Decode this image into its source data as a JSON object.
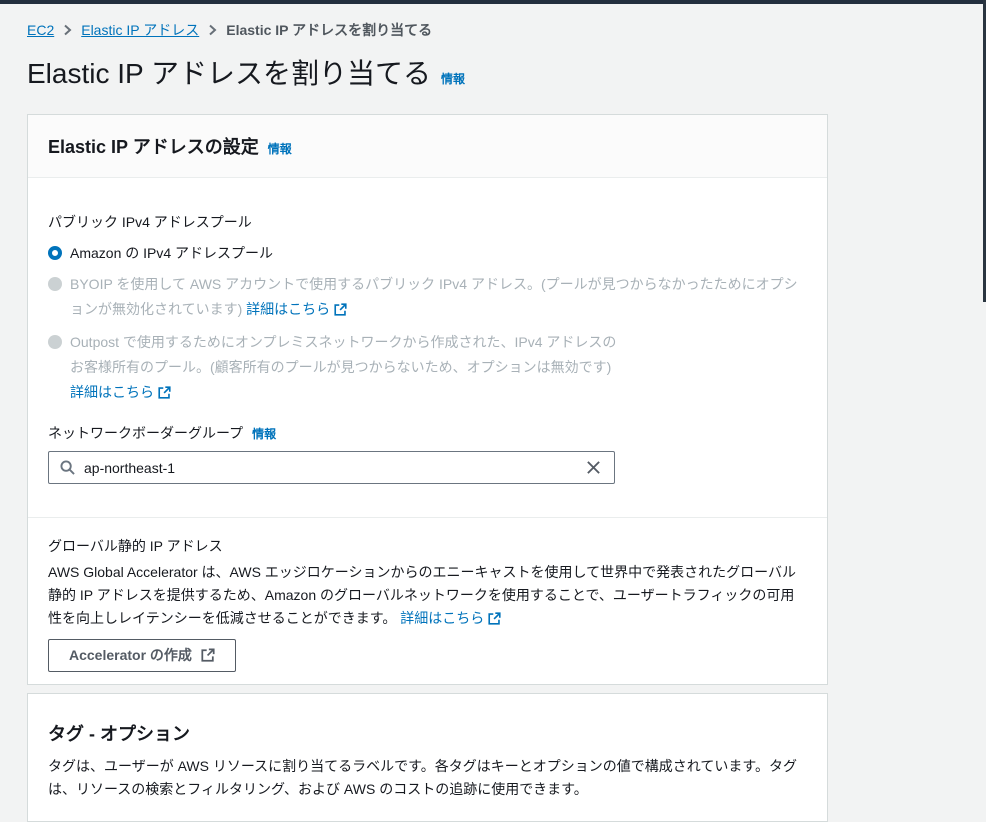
{
  "breadcrumb": {
    "items": [
      "EC2",
      "Elastic IP アドレス",
      "Elastic IP アドレスを割り当てる"
    ]
  },
  "header": {
    "title": "Elastic IP アドレスを割り当てる",
    "info_label": "情報"
  },
  "settings_card": {
    "title": "Elastic IP アドレスの設定",
    "info_label": "情報",
    "pool": {
      "label": "パブリック IPv4 アドレスプール",
      "options": [
        {
          "text": "Amazon の IPv4 アドレスプール",
          "state": "selected"
        },
        {
          "text": "BYOIP を使用して AWS アカウントで使用するパブリック IPv4 アドレス。(プールが見つからなかったためにオプションが無効化されています) ",
          "link": "詳細はこちら",
          "state": "disabled"
        },
        {
          "text": "Outpost で使用するためにオンプレミスネットワークから作成された、IPv4 アドレスのお客様所有のプール。(顧客所有のプールが見つからないため、オプションは無効です) ",
          "link": "詳細はこちら",
          "state": "disabled"
        }
      ]
    },
    "network_border_group": {
      "label": "ネットワークボーダーグループ",
      "info_label": "情報",
      "value": "ap-northeast-1"
    },
    "global_static": {
      "label": "グローバル静的 IP アドレス",
      "description": "AWS Global Accelerator は、AWS エッジロケーションからのエニーキャストを使用して世界中で発表されたグローバル静的 IP アドレスを提供するため、Amazon のグローバルネットワークを使用することで、ユーザートラフィックの可用性を向上しレイテンシーを低減させることができます。 ",
      "link": "詳細はこちら",
      "button_label": "Accelerator の作成"
    }
  },
  "tags_card": {
    "title": "タグ - オプション",
    "description": "タグは、ユーザーが AWS リソースに割り当てるラベルです。各タグはキーとオプションの値で構成されています。タグは、リソースの検索とフィルタリング、および AWS のコストの追跡に使用できます。"
  },
  "colors": {
    "top_bar": "#232f3e",
    "page_background": "#f2f3f3",
    "link_blue": "#0073bb",
    "text_dark": "#16191f",
    "disabled_text": "#a8b1b7"
  }
}
